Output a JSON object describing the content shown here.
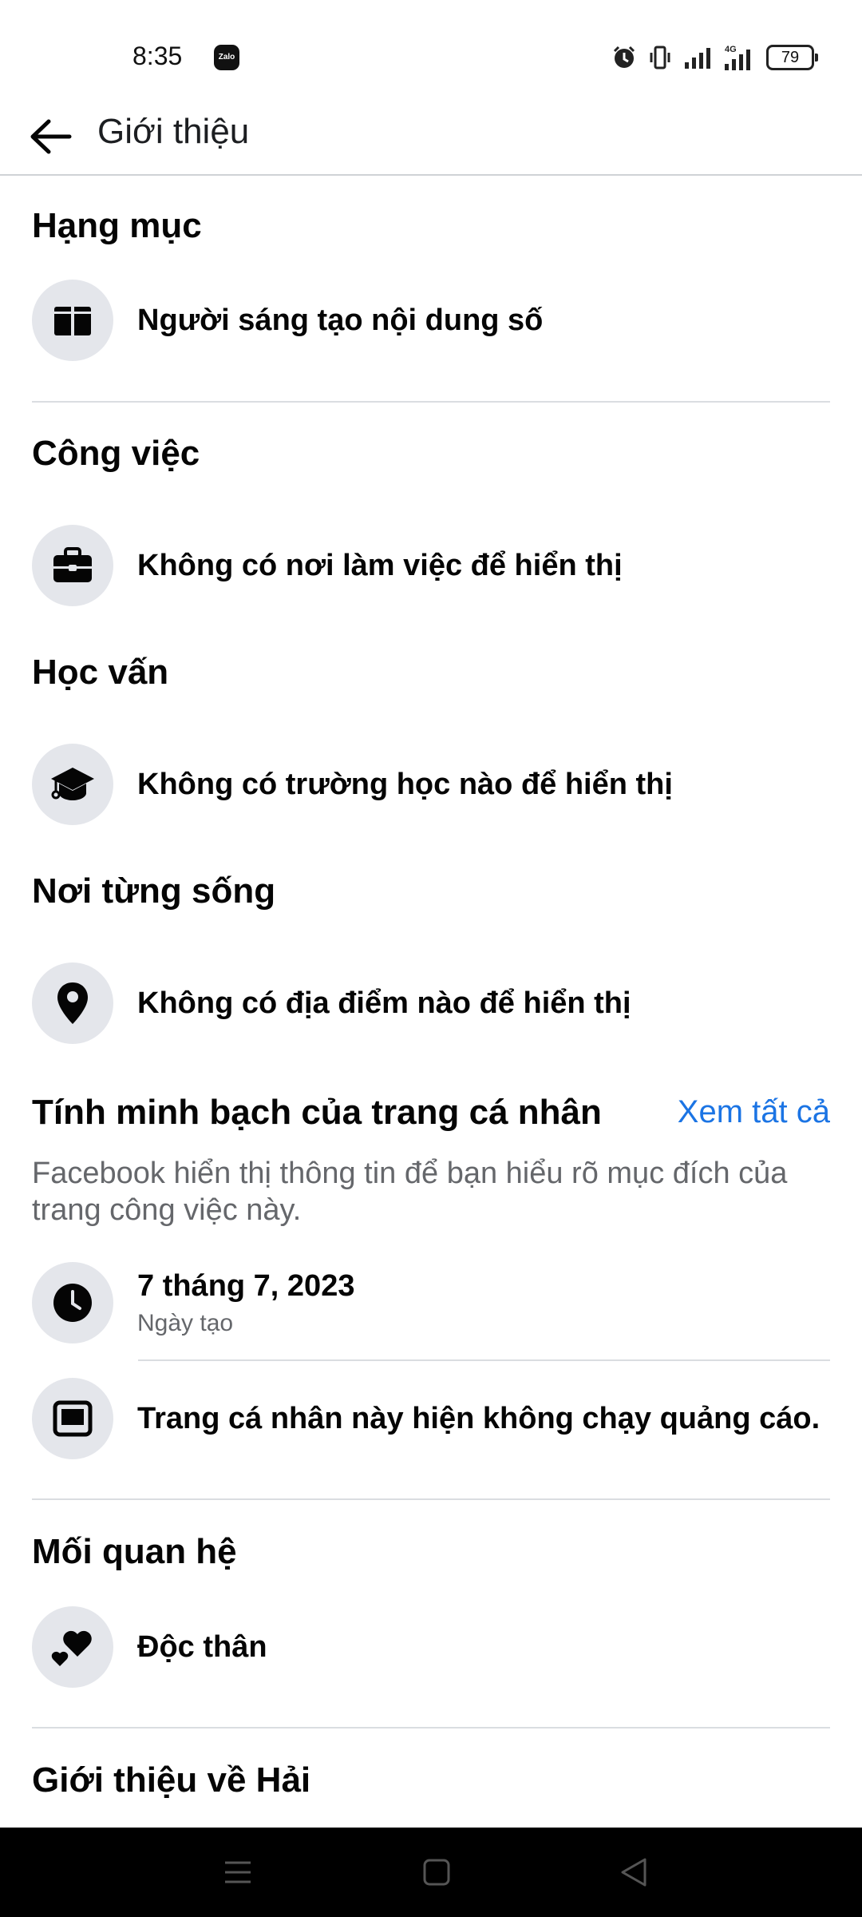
{
  "status_bar": {
    "time": "8:35",
    "zalo_label": "Zalo",
    "battery": "79"
  },
  "app_bar": {
    "title": "Giới thiệu"
  },
  "category": {
    "title": "Hạng mục",
    "value": "Người sáng tạo nội dung số"
  },
  "work": {
    "title": "Công việc",
    "value": "Không có nơi làm việc để hiển thị"
  },
  "education": {
    "title": "Học vấn",
    "value": "Không có trường học nào để hiển thị"
  },
  "places": {
    "title": "Nơi từng sống",
    "value": "Không có địa điểm nào để hiển thị"
  },
  "transparency": {
    "title": "Tính minh bạch của trang cá nhân",
    "see_all": "Xem tất cả",
    "description": "Facebook hiển thị thông tin để bạn hiểu rõ mục đích của trang công việc này.",
    "created_date": "7 tháng 7, 2023",
    "created_label": "Ngày tạo",
    "ads_status": "Trang cá nhân này hiện không chạy quảng cáo."
  },
  "relationship": {
    "title": "Mối quan hệ",
    "value": "Độc thân"
  },
  "about": {
    "title": "Giới thiệu về Hải"
  },
  "colors": {
    "accent": "#1b74e4",
    "icon_bg": "#e4e6eb",
    "divider": "#dadde1"
  }
}
